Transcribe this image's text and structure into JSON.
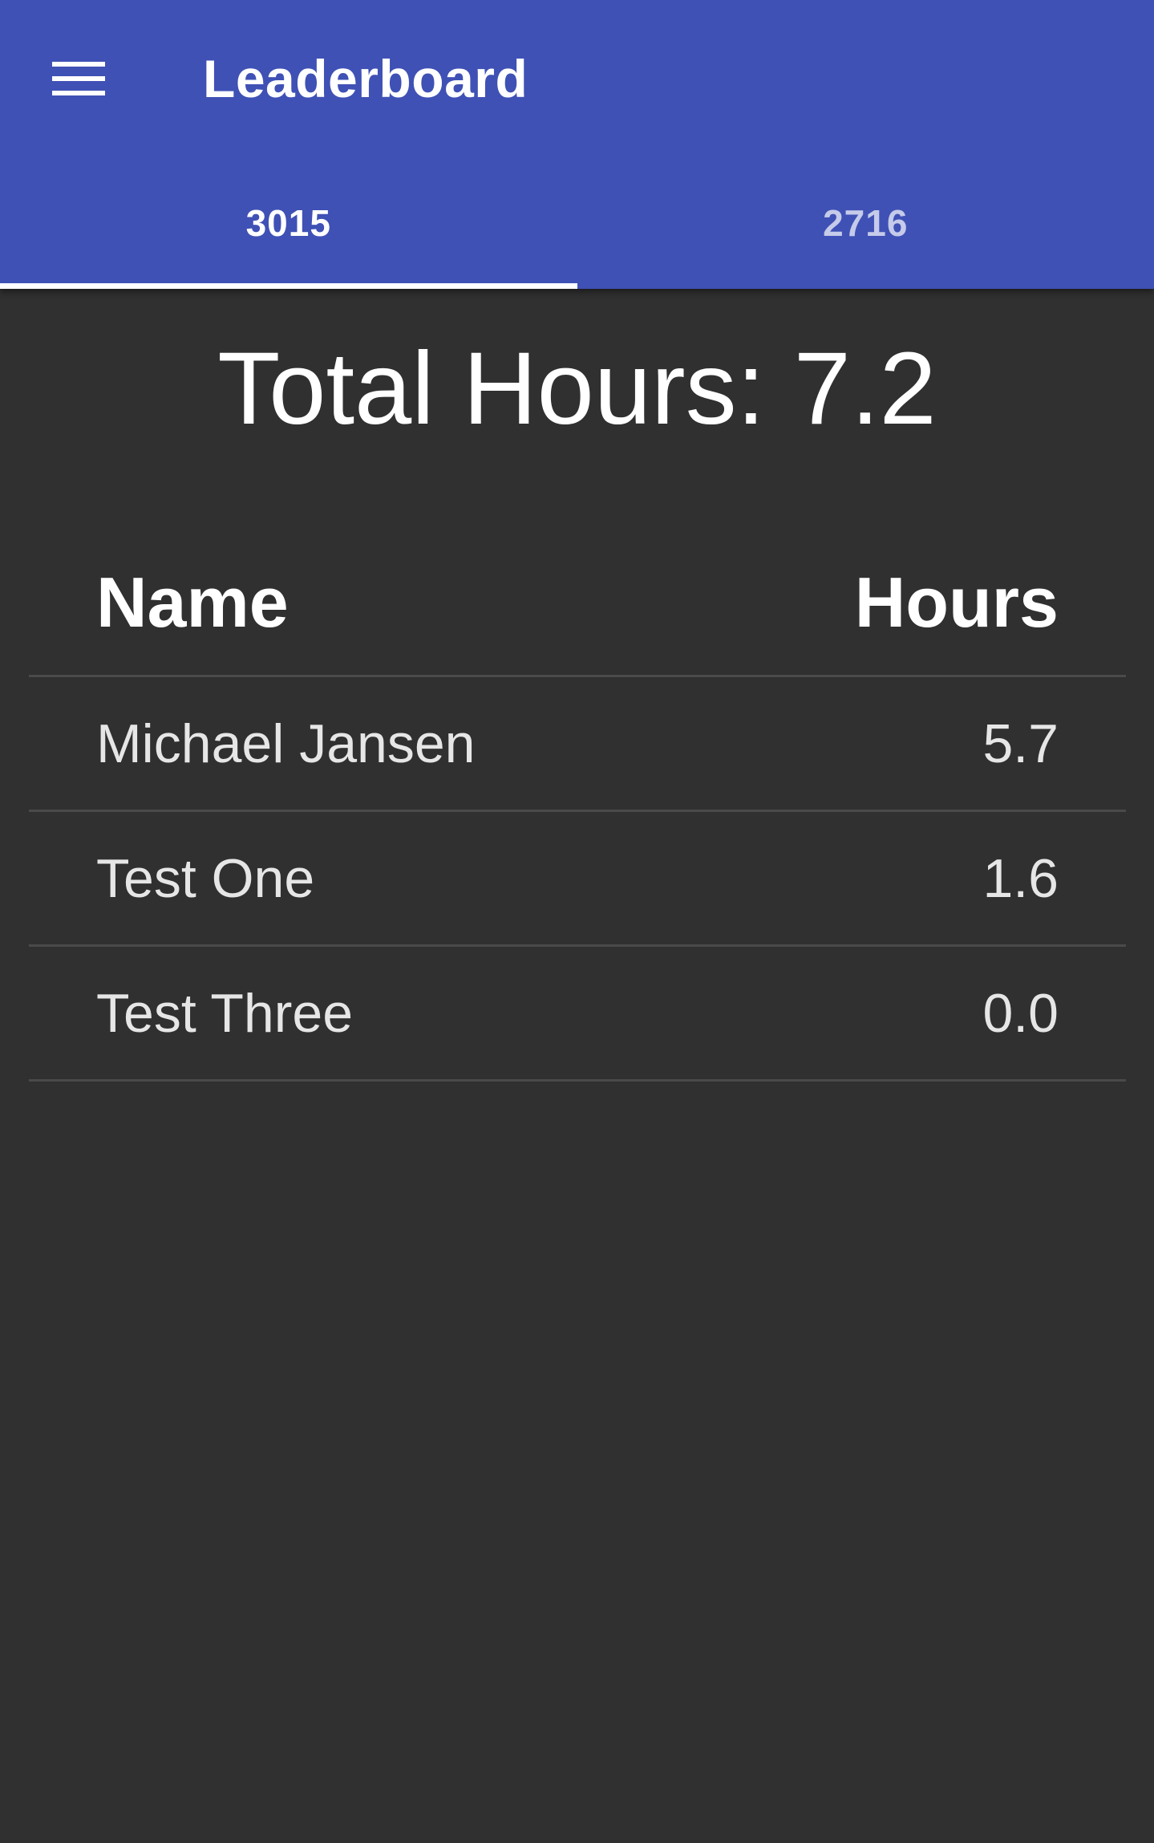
{
  "toolbar": {
    "menu_icon": "menu-icon",
    "title": "Leaderboard"
  },
  "tabs": [
    {
      "label": "3015",
      "active": true
    },
    {
      "label": "2716",
      "active": false
    }
  ],
  "summary": {
    "total_hours_text": "Total Hours: 7.2"
  },
  "table": {
    "headers": {
      "name": "Name",
      "hours": "Hours"
    },
    "rows": [
      {
        "name": "Michael Jansen",
        "hours": "5.7"
      },
      {
        "name": "Test One",
        "hours": "1.6"
      },
      {
        "name": "Test Three",
        "hours": "0.0"
      }
    ]
  },
  "colors": {
    "app_bar": "#3f51b5",
    "background": "#303030",
    "divider": "#4a4a4a"
  }
}
